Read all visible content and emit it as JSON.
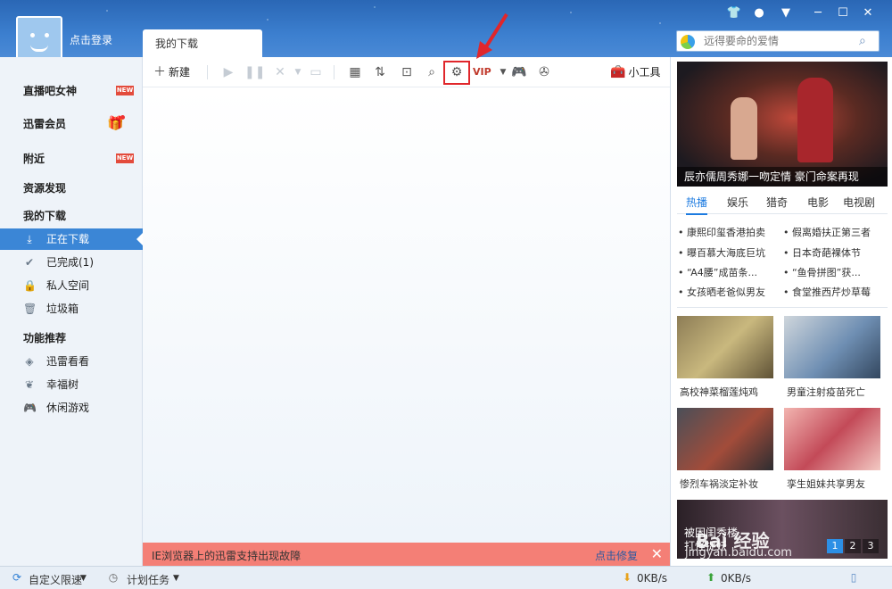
{
  "header": {
    "login_label": "点击登录",
    "window_controls": [
      "shirt-icon",
      "user-icon",
      "menu-icon",
      "minimize-icon",
      "close-icon"
    ],
    "search_placeholder": "远得要命的爱情"
  },
  "tabs": [
    {
      "label": "我的下载",
      "active": true
    }
  ],
  "sidebar": {
    "top_items": [
      {
        "label": "直播吧女神",
        "badge": "NEW"
      },
      {
        "label": "迅雷会员",
        "badge": "gift"
      },
      {
        "label": "附近",
        "badge": "NEW"
      },
      {
        "label": "资源发现"
      }
    ],
    "downloads_title": "我的下载",
    "downloads": [
      {
        "label": "正在下载",
        "icon": "download-icon",
        "active": true
      },
      {
        "label": "已完成(1)",
        "icon": "check-icon"
      },
      {
        "label": "私人空间",
        "icon": "lock-icon"
      },
      {
        "label": "垃圾箱",
        "icon": "trash-icon"
      }
    ],
    "features_title": "功能推荐",
    "features": [
      {
        "label": "迅雷看看",
        "icon": "shield-icon"
      },
      {
        "label": "幸福树",
        "icon": "leaf-icon"
      },
      {
        "label": "休闲游戏",
        "icon": "gamepad-icon"
      }
    ]
  },
  "toolbar": {
    "new_label": "新建",
    "tools_label": "小工具"
  },
  "notice": {
    "message": "IE浏览器上的迅雷支持出现故障",
    "fix_label": "点击修复"
  },
  "right_panel": {
    "hero_caption": "辰亦儒周秀娜一吻定情 豪门命案再现",
    "tabs": [
      "热播",
      "娱乐",
      "猎奇",
      "电影",
      "电视剧"
    ],
    "active_tab": "热播",
    "news": [
      "• 康熙印玺香港拍卖",
      "• 假离婚扶正第三者",
      "• 曝百慕大海底巨坑",
      "• 日本奇葩裸体节",
      "• “A4腰”成苗条...",
      "• “鱼骨拼图”获...",
      "• 女孩晒老爸似男友",
      "• 食堂推西芹炒草莓"
    ],
    "thumbs": [
      {
        "caption": "高校神菜榴莲炖鸡"
      },
      {
        "caption": "男童注射疫苗死亡"
      },
      {
        "caption": "惨烈车祸淡定补妆"
      },
      {
        "caption": "孪生姐妹共享男友"
      }
    ],
    "banner_caption_1": "被困闺秀楼",
    "banner_caption_2": "打怪捉妖",
    "pager": [
      "1",
      "2",
      "3"
    ],
    "watermark": "Bai 经验",
    "watermark_url": "jingyan.baidu.com"
  },
  "statusbar": {
    "speed_limit": "自定义限速",
    "schedule": "计划任务",
    "down_speed": "0KB/s",
    "up_speed": "0KB/s"
  }
}
